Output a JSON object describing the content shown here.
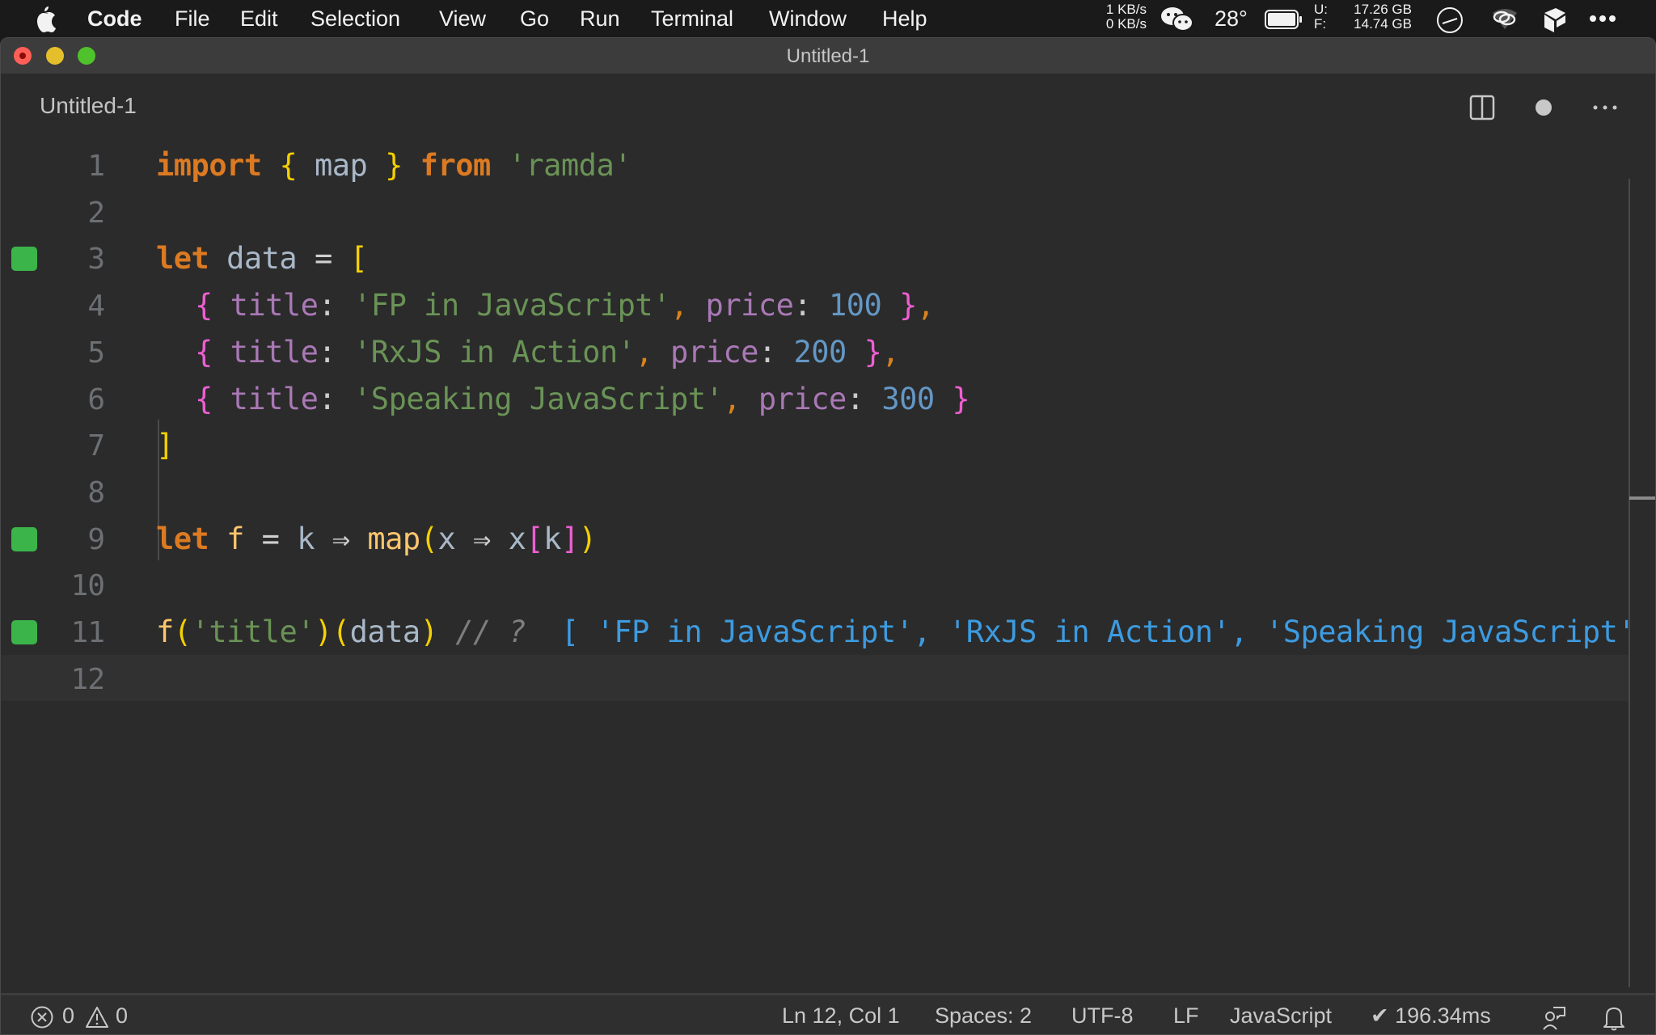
{
  "menubar": {
    "app_name": "Code",
    "items": [
      "File",
      "Edit",
      "Selection",
      "View",
      "Go",
      "Run",
      "Terminal",
      "Window",
      "Help"
    ],
    "net_up": "1 KB/s",
    "net_down": "0 KB/s",
    "temperature": "28°",
    "disk_used_label": "U:",
    "disk_used": "17.26 GB",
    "disk_free_label": "F:",
    "disk_free": "14.74 GB",
    "icons": [
      "apple-icon",
      "wechat-icon",
      "battery-icon",
      "clock-icon",
      "link-icon",
      "box-icon",
      "more-icon"
    ]
  },
  "window": {
    "title": "Untitled-1"
  },
  "tab": {
    "label": "Untitled-1",
    "actions": [
      "split-editor-icon",
      "unsaved-dot-icon",
      "more-actions-icon"
    ]
  },
  "editor": {
    "current_line": 12,
    "lines": [
      {
        "n": "1",
        "marker": false
      },
      {
        "n": "2",
        "marker": false
      },
      {
        "n": "3",
        "marker": true
      },
      {
        "n": "4",
        "marker": false
      },
      {
        "n": "5",
        "marker": false
      },
      {
        "n": "6",
        "marker": false
      },
      {
        "n": "7",
        "marker": false
      },
      {
        "n": "8",
        "marker": false
      },
      {
        "n": "9",
        "marker": true
      },
      {
        "n": "10",
        "marker": false
      },
      {
        "n": "11",
        "marker": true
      },
      {
        "n": "12",
        "marker": false
      }
    ],
    "tokens": {
      "l1": [
        "import",
        " ",
        "{",
        " ",
        "map",
        " ",
        "}",
        " ",
        "from",
        " ",
        "'ramda'"
      ],
      "l3": [
        "let",
        " ",
        "data",
        " ",
        "=",
        " ",
        "["
      ],
      "l4": [
        "{",
        " ",
        "title",
        ":",
        " ",
        "'FP in JavaScript'",
        ",",
        " ",
        "price",
        ":",
        " ",
        "100",
        " ",
        "}",
        ","
      ],
      "l5": [
        "{",
        " ",
        "title",
        ":",
        " ",
        "'RxJS in Action'",
        ",",
        " ",
        "price",
        ":",
        " ",
        "200",
        " ",
        "}",
        ","
      ],
      "l6": [
        "{",
        " ",
        "title",
        ":",
        " ",
        "'Speaking JavaScript'",
        ",",
        " ",
        "price",
        ":",
        " ",
        "300",
        " ",
        "}"
      ],
      "l7": [
        "]"
      ],
      "l9": [
        "let",
        " ",
        "f",
        " ",
        "=",
        " ",
        "k",
        " ",
        "⇒",
        " ",
        "map",
        "(",
        "x",
        " ",
        "⇒",
        " ",
        "x",
        "[",
        "k",
        "]",
        ")"
      ],
      "l11": [
        "f",
        "(",
        "'title'",
        ")",
        "(",
        "data",
        ")",
        " ",
        "// ?",
        "  ",
        "[ 'FP in JavaScript', 'RxJS in Action', 'Speaking JavaScript' ]"
      ]
    }
  },
  "statusbar": {
    "errors": "0",
    "warnings": "0",
    "position": "Ln 12, Col 1",
    "indent": "Spaces: 2",
    "encoding": "UTF-8",
    "eol": "LF",
    "language": "JavaScript",
    "timing": "✔ 196.34ms"
  },
  "colors": {
    "marker_green": "#3bb44a",
    "keyword": "#dc7a22",
    "string": "#6a9356",
    "number": "#6497c4",
    "property": "#a978b5",
    "result": "#3d9be0"
  }
}
